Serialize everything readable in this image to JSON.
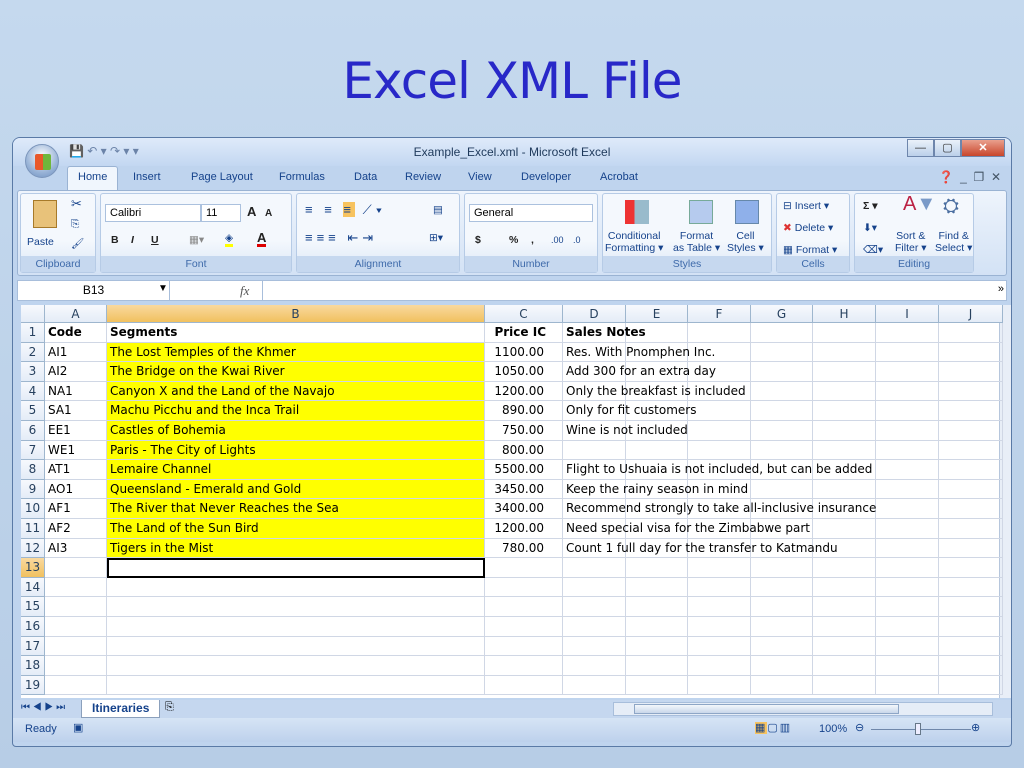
{
  "slide_title": "Excel XML File",
  "window_title": "Example_Excel.xml - Microsoft Excel",
  "tabs": [
    "Home",
    "Insert",
    "Page Layout",
    "Formulas",
    "Data",
    "Review",
    "View",
    "Developer",
    "Acrobat"
  ],
  "ribbon": {
    "clipboard": {
      "paste": "Paste",
      "label": "Clipboard"
    },
    "font": {
      "name": "Calibri",
      "size": "11",
      "label": "Font",
      "bold": "B",
      "italic": "I",
      "underline": "U",
      "grow": "A",
      "shrink": "A",
      "color": "A"
    },
    "alignment": {
      "label": "Alignment"
    },
    "number": {
      "format": "General",
      "label": "Number",
      "currency": "$",
      "percent": "%",
      "comma": ",",
      "inc": ".00",
      "dec": ".0"
    },
    "styles": {
      "conditional": "Conditional",
      "formatting": "Formatting ▾",
      "format_as": "Format",
      "as_table": "as Table ▾",
      "cell": "Cell",
      "cell_styles": "Styles ▾",
      "label": "Styles"
    },
    "cells": {
      "insert": "Insert ▾",
      "delete": "Delete ▾",
      "format": "Format ▾",
      "label": "Cells"
    },
    "editing": {
      "sum": "Σ ▾",
      "sort1": "Sort &",
      "sort2": "Filter ▾",
      "find1": "Find &",
      "find2": "Select ▾",
      "label": "Editing"
    }
  },
  "name_box": "B13",
  "fx": "fx",
  "columns": [
    "A",
    "B",
    "C",
    "D",
    "E",
    "F",
    "G",
    "H",
    "I",
    "J"
  ],
  "header_row": [
    "Code",
    "Segments",
    "Price IC",
    "Sales Notes"
  ],
  "rows": [
    [
      "AI1",
      "The Lost Temples of the Khmer",
      "1100.00",
      "Res. With Pnomphen Inc."
    ],
    [
      "AI2",
      "The Bridge on the Kwai River",
      "1050.00",
      "Add 300 for an extra day"
    ],
    [
      "NA1",
      "Canyon X and the Land of the Navajo",
      "1200.00",
      "Only the breakfast is included"
    ],
    [
      "SA1",
      "Machu Picchu and the Inca Trail",
      "890.00",
      "Only for fit customers"
    ],
    [
      "EE1",
      "Castles of Bohemia",
      "750.00",
      "Wine is not included"
    ],
    [
      "WE1",
      "Paris - The City of Lights",
      "800.00",
      ""
    ],
    [
      "AT1",
      "Lemaire Channel",
      "5500.00",
      "Flight to Ushuaia is not included, but can be added"
    ],
    [
      "AO1",
      "Queensland - Emerald and Gold",
      "3450.00",
      "Keep the rainy season in mind"
    ],
    [
      "AF1",
      "The River that Never Reaches the Sea",
      "3400.00",
      "Recommend strongly to take all-inclusive insurance"
    ],
    [
      "AF2",
      "The Land of the Sun Bird",
      "1200.00",
      "Need special visa for the Zimbabwe part"
    ],
    [
      "AI3",
      "Tigers in the Mist",
      "780.00",
      "Count 1 full day for the transfer to Katmandu"
    ]
  ],
  "row_numbers": [
    "1",
    "2",
    "3",
    "4",
    "5",
    "6",
    "7",
    "8",
    "9",
    "10",
    "11",
    "12",
    "13",
    "14",
    "15",
    "16",
    "17",
    "18",
    "19"
  ],
  "sheet_tab": "Itineraries",
  "status": {
    "ready": "Ready",
    "zoom": "100%"
  },
  "colors": {
    "highlight": "#ffff00",
    "title": "#2828c8"
  }
}
